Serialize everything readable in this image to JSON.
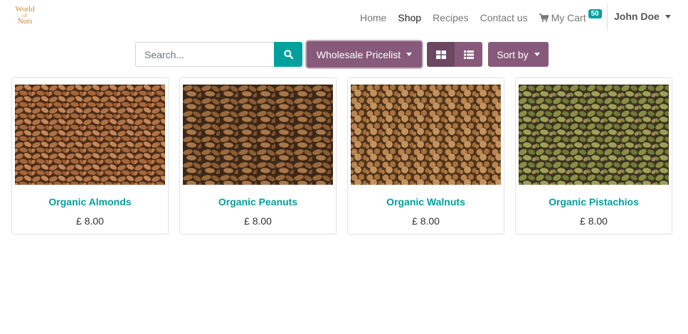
{
  "logo": {
    "line1": "World",
    "line2": "of",
    "line3": "Nuts"
  },
  "nav": {
    "items": [
      {
        "label": "Home"
      },
      {
        "label": "Shop"
      },
      {
        "label": "Recipes"
      },
      {
        "label": "Contact us"
      }
    ],
    "cart": {
      "label": "My Cart",
      "count": "50",
      "icon": "shopping-cart-icon"
    },
    "user": {
      "name": "John Doe"
    }
  },
  "toolbar": {
    "search_placeholder": "Search...",
    "search_icon": "search-icon",
    "pricelist_label": "Wholesale Pricelist",
    "view_grid_icon": "grid-view-icon",
    "view_list_icon": "list-view-icon",
    "sort_label": "Sort by"
  },
  "products": [
    {
      "name": "Organic Almonds",
      "price": "£ 8.00"
    },
    {
      "name": "Organic Peanuts",
      "price": "£ 8.00"
    },
    {
      "name": "Organic Walnuts",
      "price": "£ 8.00"
    },
    {
      "name": "Organic Pistachios",
      "price": "£ 8.00"
    }
  ],
  "colors": {
    "accent": "#00a09d",
    "primary": "#875a7b",
    "primary_dark": "#6b4762",
    "logo": "#c58a3c"
  }
}
